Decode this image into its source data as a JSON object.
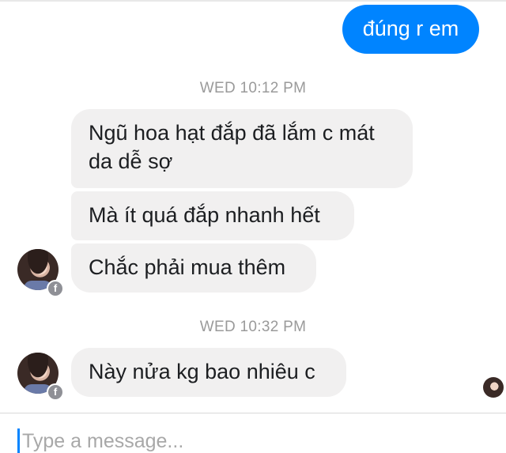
{
  "conversation": {
    "messages": [
      {
        "id": "m1",
        "direction": "outgoing",
        "text": "đúng r em"
      },
      {
        "id": "m2",
        "direction": "incoming",
        "text": "Ngũ hoa hạt đắp đã lắm c mát da dễ sợ"
      },
      {
        "id": "m3",
        "direction": "incoming",
        "text": "Mà ít quá đắp nhanh hết"
      },
      {
        "id": "m4",
        "direction": "incoming",
        "text": "Chắc phải mua thêm"
      },
      {
        "id": "m5",
        "direction": "incoming",
        "text": "Này nửa kg bao nhiêu c"
      }
    ],
    "timestamps": [
      "WED 10:12 PM",
      "WED 10:32 PM"
    ]
  },
  "icons": {
    "badge": "facebook-icon",
    "avatar": "contact-avatar",
    "seen": "seen-receipt-avatar"
  },
  "badge_glyph": "f",
  "composer": {
    "placeholder": "Type a message...",
    "value": ""
  },
  "colors": {
    "outgoing_bubble": "#0084ff",
    "incoming_bubble": "#f1f0f0",
    "timestamp": "#9a9a9a",
    "badge": "#8f9096"
  }
}
